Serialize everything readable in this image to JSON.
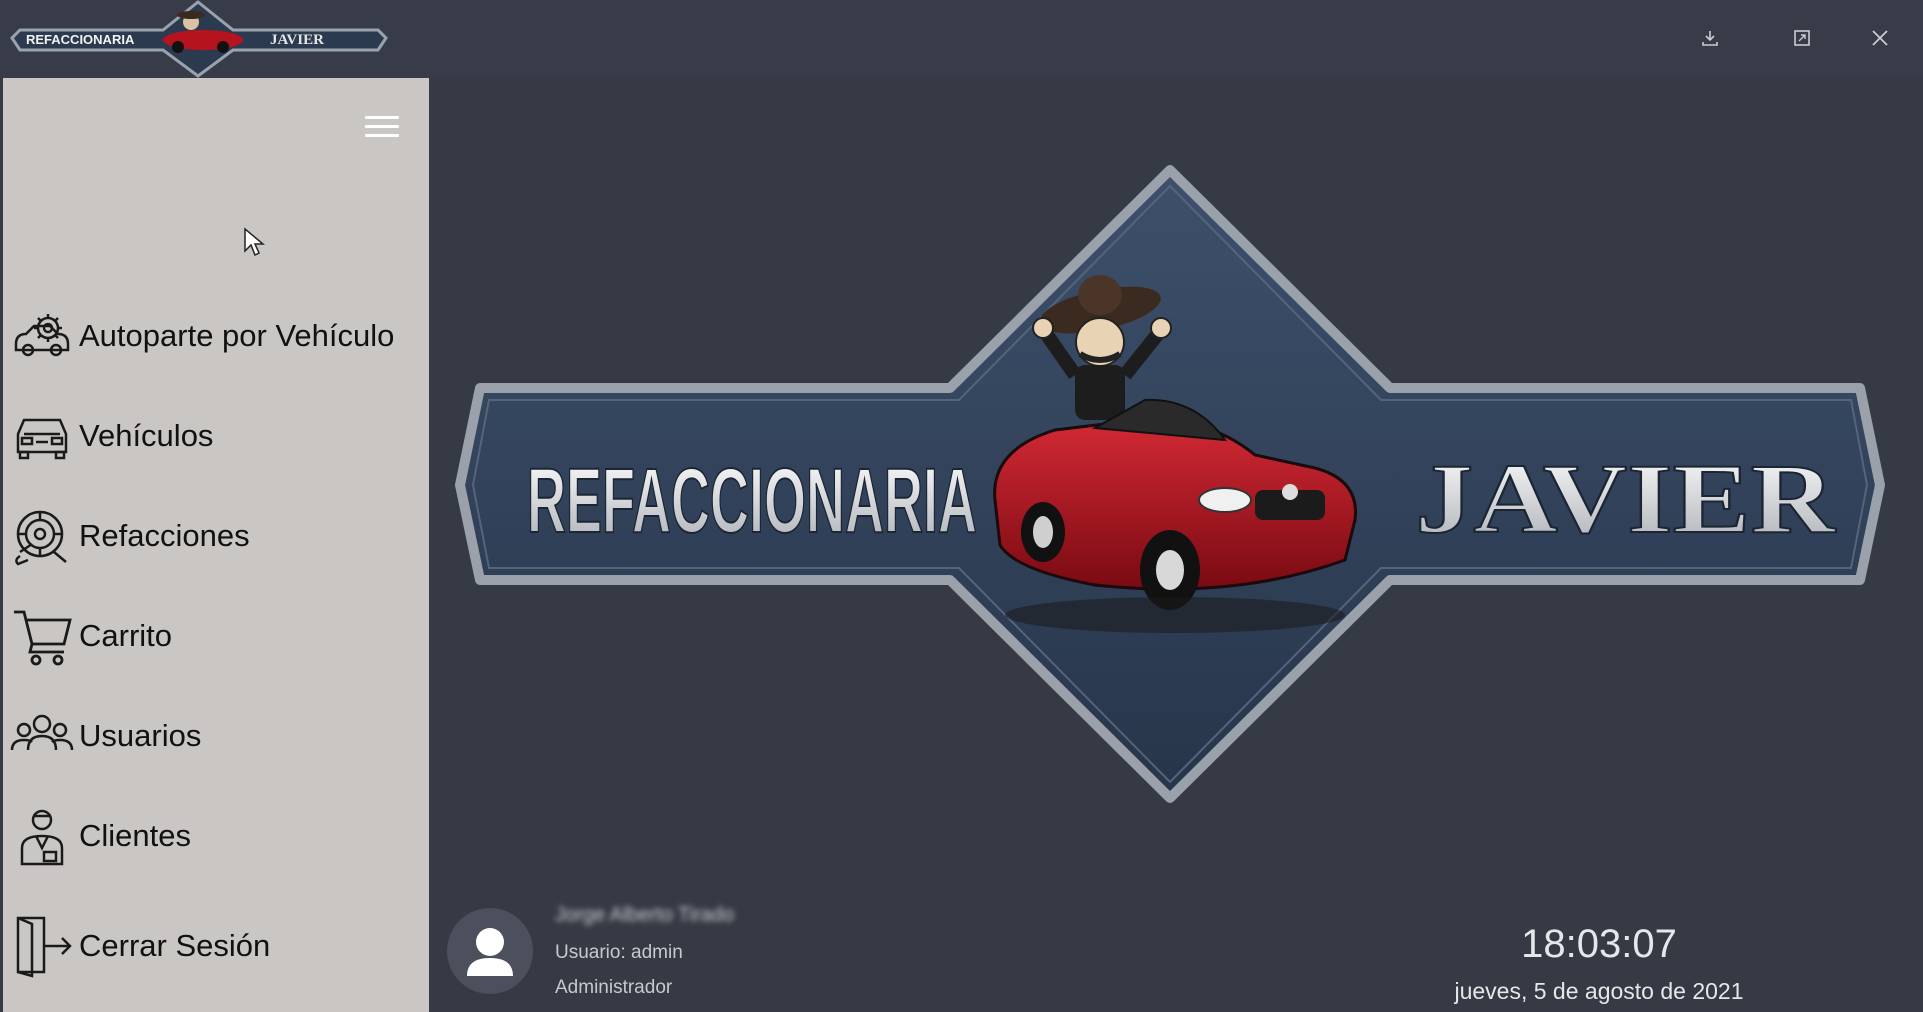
{
  "titlebar": {
    "logo_left_text": "REFACCIONARIA",
    "logo_right_text": "JAVIER",
    "buttons": [
      "minimize-icon",
      "restore-icon",
      "close-icon"
    ]
  },
  "sidebar": {
    "menu_icon": "hamburger-icon",
    "items": [
      {
        "label": "Autoparte por Vehículo",
        "icon": "car-gear-icon"
      },
      {
        "label": "Vehículos",
        "icon": "car-front-icon"
      },
      {
        "label": "Refacciones",
        "icon": "brake-disc-icon"
      },
      {
        "label": "Carrito",
        "icon": "cart-icon"
      },
      {
        "label": "Usuarios",
        "icon": "users-icon"
      },
      {
        "label": "Clientes",
        "icon": "client-icon"
      },
      {
        "label": "Cerrar Sesión",
        "icon": "logout-icon"
      }
    ]
  },
  "main_logo": {
    "left_text": "REFACCIONARIA",
    "right_text": "JAVIER"
  },
  "user_panel": {
    "name": "Jorge Alberto Tirado",
    "login": "Usuario: admin",
    "role": "Administrador",
    "time": "18:03:07",
    "date": "jueves, 5 de agosto de 2021"
  },
  "colors": {
    "background": "#363a44",
    "sidebar": "#cac6c4",
    "logo_navy": "#34465f",
    "car_red": "#b5141f"
  }
}
